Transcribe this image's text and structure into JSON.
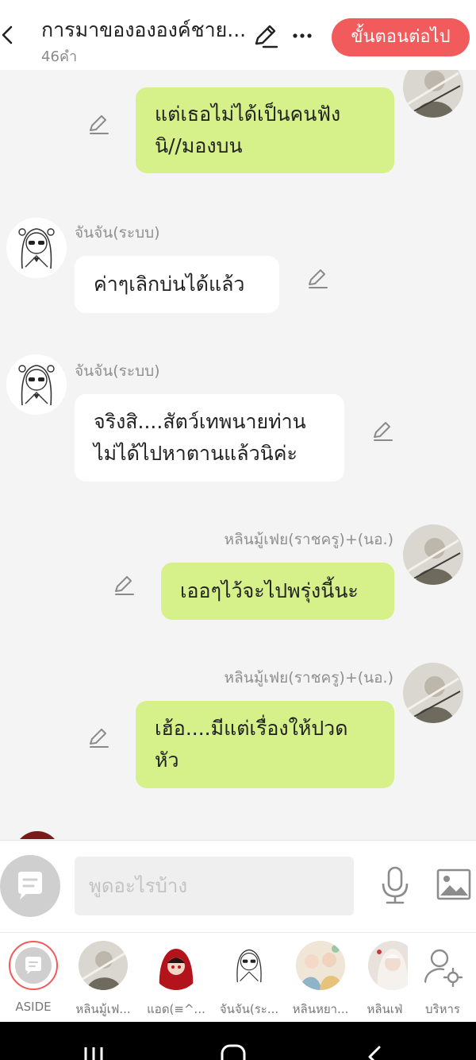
{
  "header": {
    "title": "การมาของององค์ชาย...",
    "word_count": "46คำ",
    "next_button": "ขั้นตอนต่อไป"
  },
  "messages": [
    {
      "side": "me",
      "lines": [
        "แต่เธอไม่ได้เป็นคนฟัง",
        "นิ//มองบน"
      ]
    },
    {
      "side": "them",
      "sender": "จันจัน(ระบบ)",
      "lines": [
        "ค่าๆเลิกบ่นได้แล้ว"
      ]
    },
    {
      "side": "them",
      "sender": "จันจัน(ระบบ)",
      "lines": [
        "จริงสิ....สัตว์เทพนายท่าน",
        "ไม่ได้ไปหาตานแล้วนิค่ะ"
      ]
    },
    {
      "side": "me",
      "sender": "หลินมู้เฟย(ราชครู)+(นอ.)",
      "lines": [
        "เออๆไว้จะไปพรุ่งนี้นะ"
      ]
    },
    {
      "side": "me",
      "sender": "หลินมู้เฟย(ราชครู)+(นอ.)",
      "lines": [
        "เฮ้อ....มีแต่เรื่องให้ปวด",
        "หัว"
      ]
    }
  ],
  "input": {
    "placeholder": "พูดอะไรบ้าง",
    "value": ""
  },
  "characters": [
    {
      "label": "ASIDE",
      "icon": "aside-icon"
    },
    {
      "label": "หลินมู้เฟ..."
    },
    {
      "label": "แอด(≡^..."
    },
    {
      "label": "จันจัน(ระ..."
    },
    {
      "label": "หลินหยา..."
    },
    {
      "label": "หลินเฟ่"
    },
    {
      "label": "บริหาร",
      "icon": "manage-icon"
    }
  ],
  "colors": {
    "accent": "#f15b5b",
    "my_bubble": "#d6f08a",
    "their_bubble": "#ffffff",
    "background": "#f4f4f4"
  }
}
